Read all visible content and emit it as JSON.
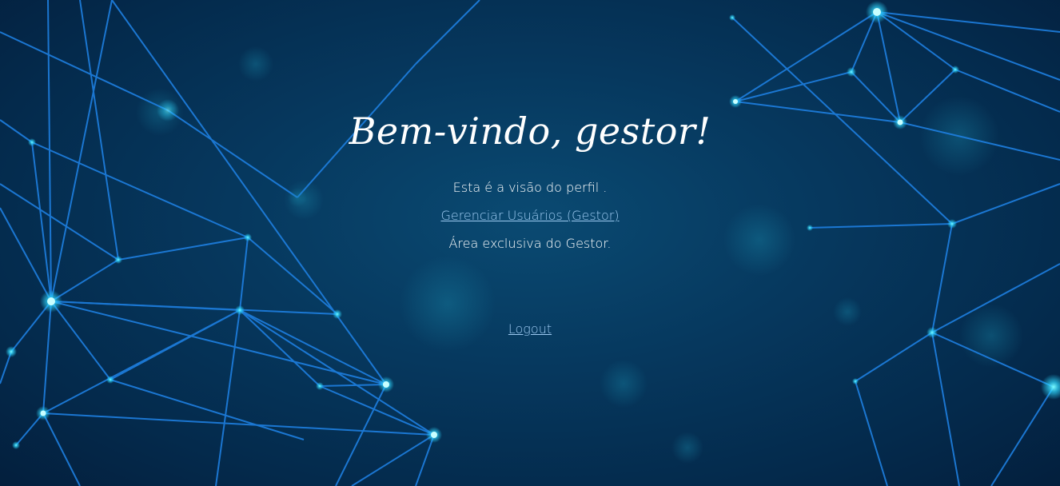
{
  "page": {
    "title": "Bem-vindo, gestor!",
    "profile_text": "Esta é a visão do perfil .",
    "manage_users_link": "Gerenciar Usuários (Gestor)",
    "exclusive_text": "Área exclusiva do Gestor.",
    "logout_link": "Logout"
  },
  "colors": {
    "background": "#06385e",
    "link": "#9ecbf2",
    "network_line": "#1e7fe0",
    "network_node": "#3ff0ff"
  }
}
